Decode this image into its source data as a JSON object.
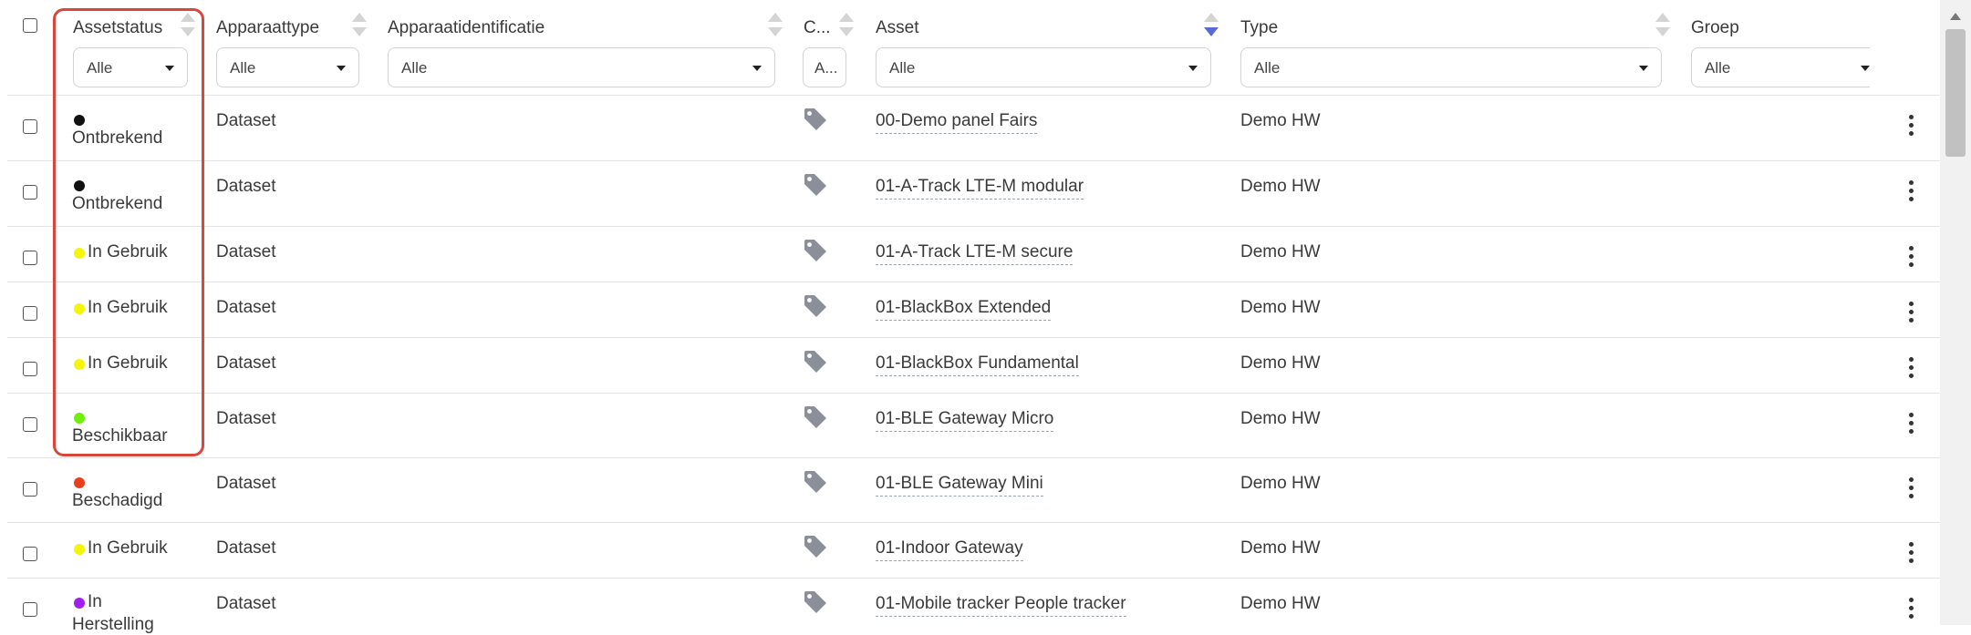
{
  "columns": {
    "assetstatus": "Assetstatus",
    "apparaattype": "Apparaattype",
    "apparaatidentificatie": "Apparaatidentificatie",
    "c": "C...",
    "asset": "Asset",
    "type": "Type",
    "groep": "Groep"
  },
  "filters": {
    "assetstatus": "Alle",
    "apparaattype": "Alle",
    "apparaatidentificatie": "Alle",
    "c": "A...",
    "asset": "Alle",
    "type": "Alle",
    "groep": "Alle"
  },
  "status_colors": {
    "Ontbrekend": "#111111",
    "In Gebruik": "#f5f50a",
    "Beschikbaar": "#6ef00a",
    "Beschadigd": "#e8401c",
    "In Herstelling": "#a020f0"
  },
  "rows": [
    {
      "status": "Ontbrekend",
      "apparaattype": "Dataset",
      "asset": "00-Demo panel Fairs",
      "type": "Demo HW"
    },
    {
      "status": "Ontbrekend",
      "apparaattype": "Dataset",
      "asset": "01-A-Track LTE-M modular",
      "type": "Demo HW"
    },
    {
      "status": "In Gebruik",
      "apparaattype": "Dataset",
      "asset": "01-A-Track LTE-M secure",
      "type": "Demo HW"
    },
    {
      "status": "In Gebruik",
      "apparaattype": "Dataset",
      "asset": "01-BlackBox Extended",
      "type": "Demo HW"
    },
    {
      "status": "In Gebruik",
      "apparaattype": "Dataset",
      "asset": "01-BlackBox Fundamental",
      "type": "Demo HW"
    },
    {
      "status": "Beschikbaar",
      "apparaattype": "Dataset",
      "asset": "01-BLE Gateway Micro",
      "type": "Demo HW"
    },
    {
      "status": "Beschadigd",
      "apparaattype": "Dataset",
      "asset": "01-BLE Gateway Mini",
      "type": "Demo HW"
    },
    {
      "status": "In Gebruik",
      "apparaattype": "Dataset",
      "asset": "01-Indoor Gateway",
      "type": "Demo HW"
    },
    {
      "status_line1": "In",
      "status_line2": "Herstelling",
      "status": "In Herstelling",
      "apparaattype": "Dataset",
      "asset": "01-Mobile tracker People tracker",
      "type": "Demo HW"
    }
  ]
}
